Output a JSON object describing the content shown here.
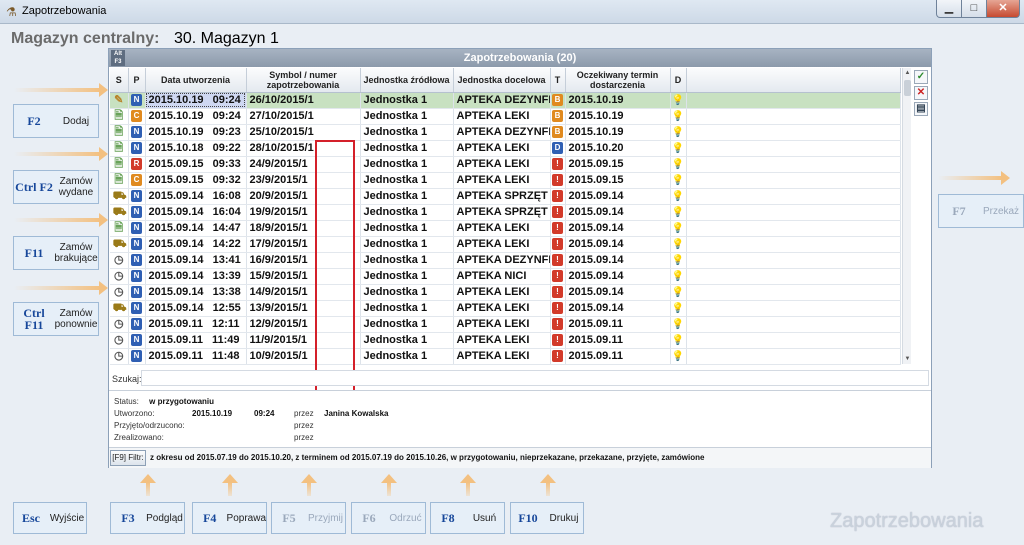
{
  "window": {
    "title": "Zapotrzebowania"
  },
  "heading": {
    "label": "Magazyn centralny:",
    "value": "30. Magazyn 1"
  },
  "panel": {
    "title": "Zapotrzebowania (20)",
    "altf3_line1": "Alt",
    "altf3_line2": "F3"
  },
  "columns": {
    "s": "S",
    "p": "P",
    "date": "Data utworzenia",
    "symbol": "Symbol / numer zapotrzebowania",
    "src": "Jednostka źródłowa",
    "dst": "Jednostka docelowa",
    "t": "T",
    "expected": "Oczekiwany termin dostarczenia",
    "d": "D"
  },
  "rows": [
    {
      "s": "edit",
      "p": "N",
      "date": "2015.10.19",
      "time": "09:24",
      "symbol": "26/10/2015/1",
      "src": "Jednostka 1",
      "dst": "APTEKA DEZYNFE",
      "t": "B",
      "expected": "2015.10.19",
      "d": "bulb"
    },
    {
      "s": "doc",
      "p": "C",
      "date": "2015.10.19",
      "time": "09:24",
      "symbol": "27/10/2015/1",
      "src": "Jednostka 1",
      "dst": "APTEKA LEKI",
      "t": "B",
      "expected": "2015.10.19",
      "d": "bulb"
    },
    {
      "s": "doc",
      "p": "N",
      "date": "2015.10.19",
      "time": "09:23",
      "symbol": "25/10/2015/1",
      "src": "Jednostka 1",
      "dst": "APTEKA DEZYNFE",
      "t": "B",
      "expected": "2015.10.19",
      "d": "bulb"
    },
    {
      "s": "doc",
      "p": "N",
      "date": "2015.10.18",
      "time": "09:22",
      "symbol": "28/10/2015/1",
      "src": "Jednostka 1",
      "dst": "APTEKA LEKI",
      "t": "D",
      "expected": "2015.10.20",
      "d": "bulb"
    },
    {
      "s": "doc",
      "p": "R",
      "date": "2015.09.15",
      "time": "09:33",
      "symbol": "24/9/2015/1",
      "src": "Jednostka 1",
      "dst": "APTEKA LEKI",
      "t": "!",
      "expected": "2015.09.15",
      "d": "bulb"
    },
    {
      "s": "doc",
      "p": "C",
      "date": "2015.09.15",
      "time": "09:32",
      "symbol": "23/9/2015/1",
      "src": "Jednostka 1",
      "dst": "APTEKA LEKI",
      "t": "!",
      "expected": "2015.09.15",
      "d": "bulb"
    },
    {
      "s": "truck",
      "p": "N",
      "date": "2015.09.14",
      "time": "16:08",
      "symbol": "20/9/2015/1",
      "src": "Jednostka 1",
      "dst": "APTEKA SPRZĘT N",
      "t": "!",
      "expected": "2015.09.14",
      "d": "bulb"
    },
    {
      "s": "truck",
      "p": "N",
      "date": "2015.09.14",
      "time": "16:04",
      "symbol": "19/9/2015/1",
      "src": "Jednostka 1",
      "dst": "APTEKA SPRZĘT N",
      "t": "!",
      "expected": "2015.09.14",
      "d": "bulb"
    },
    {
      "s": "doc",
      "p": "N",
      "date": "2015.09.14",
      "time": "14:47",
      "symbol": "18/9/2015/1",
      "src": "Jednostka 1",
      "dst": "APTEKA LEKI",
      "t": "!",
      "expected": "2015.09.14",
      "d": "bulb"
    },
    {
      "s": "truck",
      "p": "N",
      "date": "2015.09.14",
      "time": "14:22",
      "symbol": "17/9/2015/1",
      "src": "Jednostka 1",
      "dst": "APTEKA LEKI",
      "t": "!",
      "expected": "2015.09.14",
      "d": "bulb-on"
    },
    {
      "s": "clock",
      "p": "N",
      "date": "2015.09.14",
      "time": "13:41",
      "symbol": "16/9/2015/1",
      "src": "Jednostka 1",
      "dst": "APTEKA DEZYNFE",
      "t": "!",
      "expected": "2015.09.14",
      "d": "bulb"
    },
    {
      "s": "clock",
      "p": "N",
      "date": "2015.09.14",
      "time": "13:39",
      "symbol": "15/9/2015/1",
      "src": "Jednostka 1",
      "dst": "APTEKA NICI",
      "t": "!",
      "expected": "2015.09.14",
      "d": "bulb"
    },
    {
      "s": "clock",
      "p": "N",
      "date": "2015.09.14",
      "time": "13:38",
      "symbol": "14/9/2015/1",
      "src": "Jednostka 1",
      "dst": "APTEKA LEKI",
      "t": "!",
      "expected": "2015.09.14",
      "d": "bulb"
    },
    {
      "s": "truck",
      "p": "N",
      "date": "2015.09.14",
      "time": "12:55",
      "symbol": "13/9/2015/1",
      "src": "Jednostka 1",
      "dst": "APTEKA LEKI",
      "t": "!",
      "expected": "2015.09.14",
      "d": "bulb-on"
    },
    {
      "s": "clock",
      "p": "N",
      "date": "2015.09.11",
      "time": "12:11",
      "symbol": "12/9/2015/1",
      "src": "Jednostka 1",
      "dst": "APTEKA LEKI",
      "t": "!",
      "expected": "2015.09.11",
      "d": "bulb"
    },
    {
      "s": "clock",
      "p": "N",
      "date": "2015.09.11",
      "time": "11:49",
      "symbol": "11/9/2015/1",
      "src": "Jednostka 1",
      "dst": "APTEKA LEKI",
      "t": "!",
      "expected": "2015.09.11",
      "d": "bulb"
    },
    {
      "s": "clock",
      "p": "N",
      "date": "2015.09.11",
      "time": "11:48",
      "symbol": "10/9/2015/1",
      "src": "Jednostka 1",
      "dst": "APTEKA LEKI",
      "t": "!",
      "expected": "2015.09.11",
      "d": "bulb"
    }
  ],
  "search": {
    "label": "Szukaj:",
    "value": ""
  },
  "info": {
    "status_label": "Status:",
    "status_value": "w przygotowaniu",
    "created_label": "Utworzono:",
    "created_date": "2015.10.19",
    "created_time": "09:24",
    "by_label": "przez",
    "created_by": "Janina Kowalska",
    "accepted_label": "Przyjęto/odrzucono:",
    "accepted_by": "przez",
    "realized_label": "Zrealizowano:",
    "realized_by": "przez"
  },
  "filter": {
    "button": "[F9] Filtr:",
    "text": "z okresu od 2015.07.19 do 2015.10.20, z terminem od 2015.07.19 do 2015.10.26, w przygotowaniu, nieprzekazane, przekazane, przyjęte, zamówione"
  },
  "side_keys": [
    {
      "key": "F2",
      "label": "Dodaj"
    },
    {
      "key": "Ctrl F2",
      "label": "Zamów wydane"
    },
    {
      "key": "F11",
      "label": "Zamów brakujące"
    },
    {
      "key": "Ctrl F11",
      "label": "Zamów ponownie"
    }
  ],
  "right_key": {
    "key": "F7",
    "label": "Przekaż"
  },
  "bottom_keys": [
    {
      "key": "Esc",
      "label": "Wyjście"
    },
    {
      "key": "F3",
      "label": "Podgląd"
    },
    {
      "key": "F4",
      "label": "Poprawa"
    },
    {
      "key": "F5",
      "label": "Przyjmij"
    },
    {
      "key": "F6",
      "label": "Odrzuć"
    },
    {
      "key": "F8",
      "label": "Usuń"
    },
    {
      "key": "F10",
      "label": "Drukuj"
    }
  ],
  "watermark": "Zapotrzebowania",
  "colors": {
    "selected_row": "#c8e1c1",
    "accent_key": "#17479a",
    "highlight_box": "#d4202a"
  }
}
